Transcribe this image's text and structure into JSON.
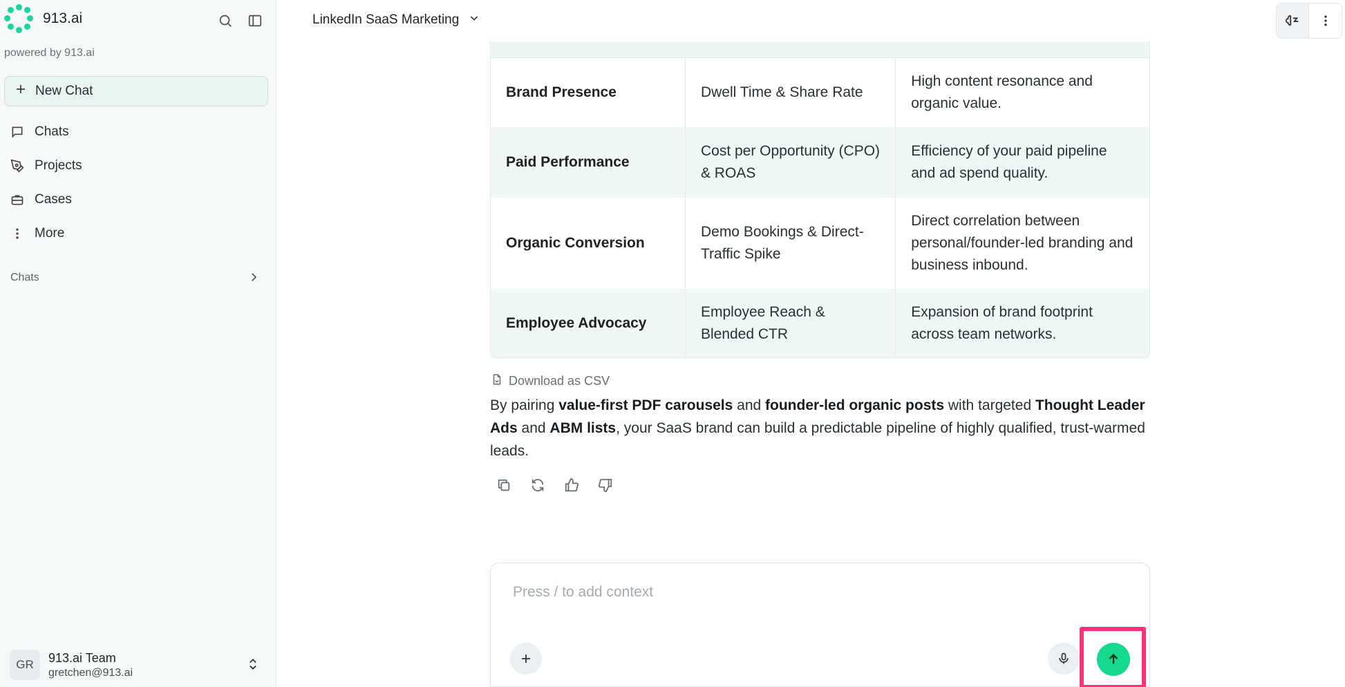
{
  "sidebar": {
    "brand": "913.ai",
    "powered_by": "powered by 913.ai",
    "new_chat": "New Chat",
    "nav": [
      {
        "label": "Chats",
        "icon": "chat-bubble-icon"
      },
      {
        "label": "Projects",
        "icon": "pen-tool-icon"
      },
      {
        "label": "Cases",
        "icon": "briefcase-icon"
      },
      {
        "label": "More",
        "icon": "vertical-dots-icon"
      }
    ],
    "section_label": "Chats",
    "user": {
      "initials": "GR",
      "name": "913.ai Team",
      "email": "gretchen@913.ai"
    }
  },
  "header": {
    "conversation_title": "LinkedIn SaaS Marketing"
  },
  "table": {
    "rows": [
      {
        "area": "Brand Presence",
        "metric": "Dwell Time & Share Rate",
        "meaning": "High content resonance and organic value."
      },
      {
        "area": "Paid Performance",
        "metric": "Cost per Opportunity (CPO) & ROAS",
        "meaning": "Efficiency of your paid pipeline and ad spend quality."
      },
      {
        "area": "Organic Conversion",
        "metric": "Demo Bookings & Direct-Traffic Spike",
        "meaning": "Direct correlation between personal/founder-led branding and business inbound."
      },
      {
        "area": "Employee Advocacy",
        "metric": "Employee Reach & Blended CTR",
        "meaning": "Expansion of brand footprint across team networks."
      }
    ]
  },
  "download_label": "Download as CSV",
  "summary": {
    "t1": "By pairing ",
    "b1": "value-first PDF carousels",
    "t2": " and ",
    "b2": "founder-led organic posts",
    "t3": " with targeted ",
    "b3": "Thought Leader Ads",
    "t4": " and ",
    "b4": "ABM lists",
    "t5": ", your SaaS brand can build a predictable pipeline of highly qualified, trust-warmed leads."
  },
  "composer": {
    "placeholder": "Press / to add context"
  },
  "colors": {
    "accent": "#14d98f",
    "highlight": "#ff2f7a",
    "row_tint": "#f0f7f5"
  }
}
